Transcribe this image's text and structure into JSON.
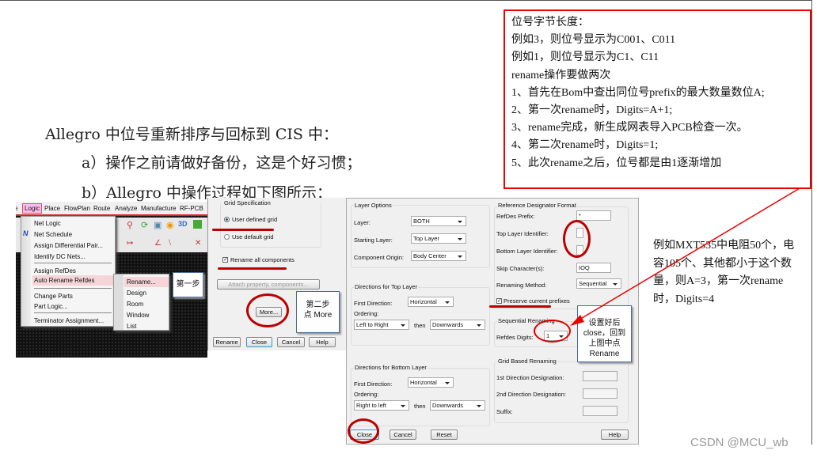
{
  "heading": {
    "title": "Allegro 中位号重新排序与回标到 CIS 中：",
    "step_a": "a）操作之前请做好备份，这是个好习惯；",
    "step_b": "b）Allegro 中操作过程如下图所示："
  },
  "note_box": {
    "border_color": "#e00000",
    "lines": [
      "位号字节长度：",
      "例如3，则位号显示为C001、C011",
      "例如1，则位号显示为C1、C11",
      "rename操作要做两次",
      "1、首先在Bom中查出同位号prefix的最大数量数位A;",
      "2、第一次rename时，Digits=A+1;",
      "3、rename完成，新生成网表导入PCB检查一次。",
      "4、第二次rename时，Digits=1;",
      "5、此次rename之后，位号都是由1逐渐增加"
    ]
  },
  "side_note": "例如MXT535中电阻50个，电容105个、其他都小于这个数量，则A=3，第一次rename时，Digits=4",
  "watermark": "CSDN @MCU_wb",
  "menu_shot": {
    "menubar": [
      "e",
      "Logic",
      "Place",
      "FlowPlan",
      "Route",
      "Analyze",
      "Manufacture",
      "RF-PCB"
    ],
    "menu_items": [
      "Net Logic",
      "Net Schedule",
      "Assign Differential Pair...",
      "Identify DC Nets...",
      "Assign RefDes",
      "Auto Rename Refdes",
      "Change Parts",
      "Part Logic...",
      "Terminator Assignment..."
    ],
    "submenu_items": [
      "Rename...",
      "Design",
      "Room",
      "Window",
      "List"
    ],
    "callout": "第一步",
    "highlight_color": "#f5d5d8"
  },
  "rename_dialog": {
    "group_title": "Grid Specification",
    "radio_user": "User defined grid",
    "radio_default": "Use default grid",
    "rename_all": "Rename all components",
    "attach_button": "Attach property, components...",
    "more_button": "More...",
    "callout": "第二步点 More",
    "buttons": [
      "Rename",
      "Close",
      "Cancel",
      "Help"
    ]
  },
  "more_dialog": {
    "layer_options": {
      "title": "Layer Options",
      "layer_label": "Layer:",
      "layer_value": "BOTH",
      "starting_label": "Starting Layer:",
      "starting_value": "Top Layer",
      "origin_label": "Component Origin:",
      "origin_value": "Body Center"
    },
    "top_dir": {
      "title": "Directions for Top Layer",
      "first_label": "First Direction:",
      "first_value": "Horizontal",
      "ordering_label": "Ordering:",
      "order1": "Left to Right",
      "then": "then",
      "order2": "Downwards"
    },
    "bottom_dir": {
      "title": "Directions for Bottom Layer",
      "first_label": "First Direction:",
      "first_value": "Horizontal",
      "ordering_label": "Ordering:",
      "order1": "Right to left",
      "then": "then",
      "order2": "Downwards"
    },
    "refdes_format": {
      "title": "Reference Designator Format",
      "prefix_label": "RefDes Prefix:",
      "prefix_value": "*",
      "top_id_label": "Top Layer Identifier:",
      "bottom_id_label": "Bottom Layer Identifier:",
      "skip_label": "Skip Character(s):",
      "skip_value": "IOQ",
      "method_label": "Renaming Method:",
      "method_value": "Sequential",
      "preserve_label": "Preserve current prefixes"
    },
    "sequential": {
      "title": "Sequential Renaming",
      "digits_label": "Refdes Digits:",
      "digits_value": "1"
    },
    "grid_based": {
      "title": "Grid Based Renaming",
      "first_label": "1st Direction Designation:",
      "second_label": "2nd Direction Designation:",
      "suffix_label": "Suffix:"
    },
    "buttons": [
      "Close",
      "Cancel",
      "Reset",
      "Help"
    ],
    "callout": "设置好后close，回到上图中点Rename"
  },
  "annotation_color": "#b00000"
}
